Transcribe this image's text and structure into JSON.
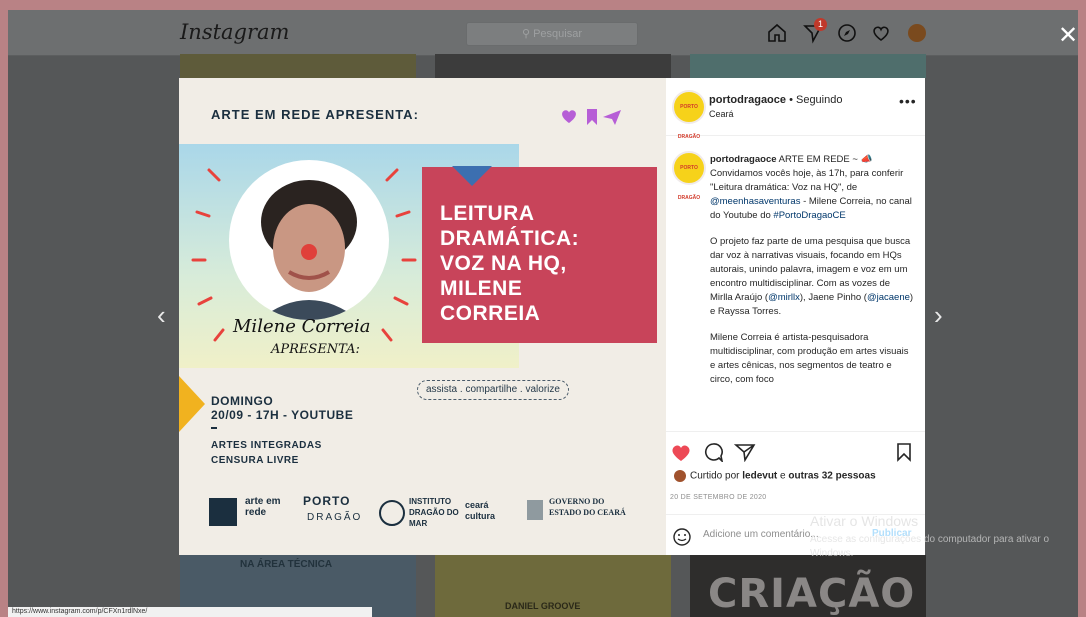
{
  "nav": {
    "logo": "Instagram",
    "search_placeholder": "Pesquisar",
    "notifications_count": "1"
  },
  "background_tiles": {
    "bottom_left": "NA ÁREA TÉCNICA",
    "bottom_middle": "DANIEL GROOVE",
    "bottom_right": "CRIAÇÃO"
  },
  "post_image": {
    "header": "ARTE EM REDE APRESENTA:",
    "hand_name": "Milene Correia",
    "hand_sub": "APRESENTA:",
    "title_lines": [
      "LEITURA",
      "DRAMÁTICA:",
      "VOZ NA HQ,",
      "MILENE",
      "CORREIA"
    ],
    "tags": "assista . compartilhe . valorize",
    "day": "DOMINGO",
    "schedule": "20/09 - 17H - YOUTUBE",
    "category": "ARTES INTEGRADAS",
    "rating": "CENSURA LIVRE",
    "logo_arte_em_rede": "arte em rede",
    "logo_porto": "PORTO",
    "logo_dragao": "DRAGÃO",
    "logo_instituto": "INSTITUTO DRAGÃO DO MAR",
    "logo_ceara": "ceará cultura",
    "logo_governo": "GOVERNO DO ESTADO DO CEARÁ"
  },
  "panel": {
    "username": "portodragaoce",
    "following": "• Seguindo",
    "location": "Ceará",
    "caption_user": "portodragaoce",
    "caption_p1_a": "ARTE EM REDE ~ 📣 Convidamos vocês hoje, às 17h, para conferir \"Leitura dramática: Voz na HQ\", de ",
    "caption_p1_link1": "@meenhasaventuras",
    "caption_p1_b": " - Milene Correia, no canal do Youtube do ",
    "caption_p1_link2": "#PortoDragaoCE",
    "caption_p2_a": "O projeto faz parte de uma pesquisa que busca dar voz à narrativas visuais, focando em HQs autorais, unindo palavra, imagem e voz em um encontro multidisciplinar. Com as vozes de Mirlla Araújo (",
    "caption_p2_link1": "@mirllx",
    "caption_p2_b": "), Jaene Pinho (",
    "caption_p2_link2": "@jacaene",
    "caption_p2_c": ") e Rayssa Torres.",
    "caption_p3": "Milene Correia é artista-pesquisadora multidisciplinar, com produção em artes visuais e artes cênicas, nos segmentos de teatro e circo, com foco",
    "likes_prefix": "Curtido por ",
    "likes_user": "ledevut",
    "likes_suffix": " e ",
    "likes_others": "outras 32 pessoas",
    "date": "20 DE SETEMBRO DE 2020",
    "comment_placeholder": "Adicione um comentário...",
    "publish": "Publicar"
  },
  "windows": {
    "activate_title": "Ativar o Windows",
    "activate_sub": "Acesse as configurações do computador para ativar o Windows."
  },
  "status_url": "https://www.instagram.com/p/CFXn1rdlNxe/"
}
